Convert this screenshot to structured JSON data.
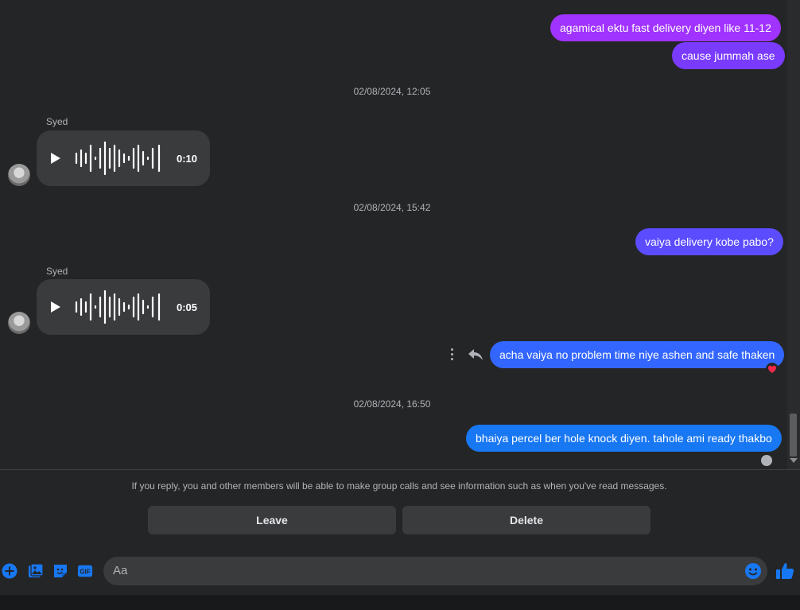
{
  "messages": {
    "m1": "agamical ektu fast delivery diyen like 11-12",
    "m2": "cause jummah ase",
    "ts1": "02/08/2024, 12:05",
    "sender1": "Syed",
    "audio1_duration": "0:10",
    "ts2": "02/08/2024, 15:42",
    "m3": "vaiya delivery kobe pabo?",
    "sender2": "Syed",
    "audio2_duration": "0:05",
    "m4": "acha vaiya no problem time niye ashen and safe thaken",
    "ts3": "02/08/2024, 16:50",
    "m5": "bhaiya percel ber hole knock diyen. tahole ami ready thakbo"
  },
  "notice": "If you reply, you and other members will be able to make group calls and see information such as when you've read messages.",
  "actions": {
    "leave": "Leave",
    "delete": "Delete"
  },
  "composer": {
    "placeholder": "Aa"
  },
  "colors": {
    "accent": "#1877f2",
    "bubble_purple": "#a033ff",
    "bubble_blue": "#3366ff"
  },
  "icons": [
    "plus-circle-icon",
    "image-icon",
    "sticker-icon",
    "gif-icon",
    "emoji-icon",
    "thumbs-up-icon",
    "play-icon",
    "reply-icon",
    "more-icon",
    "heart-reaction-icon"
  ]
}
